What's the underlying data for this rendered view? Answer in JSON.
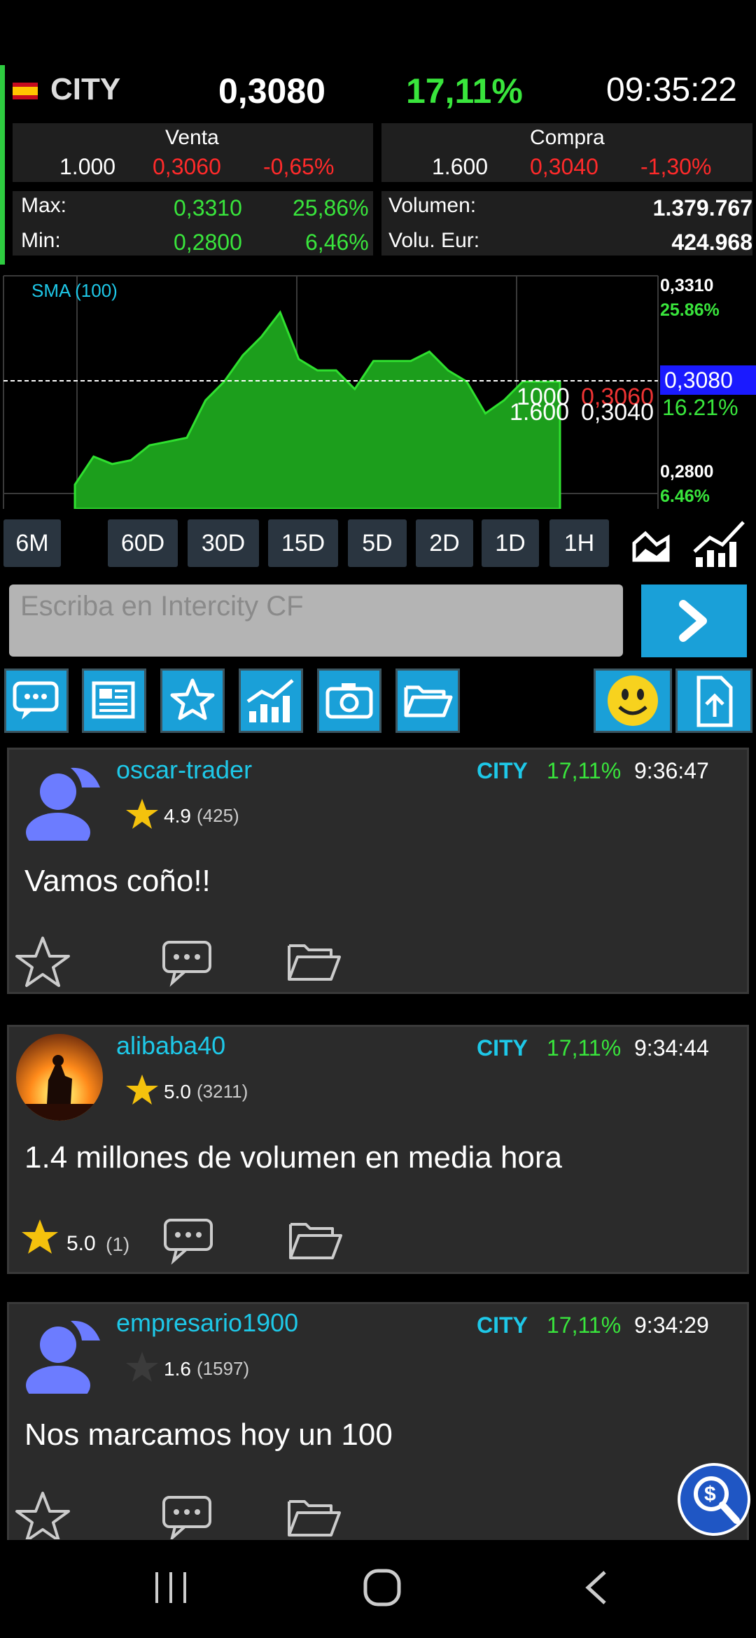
{
  "header": {
    "ticker": "CITY",
    "price": "0,3080",
    "change": "17,11%",
    "time": "09:35:22"
  },
  "orders": {
    "sell": {
      "title": "Venta",
      "qty": "1.000",
      "price": "0,3060",
      "pct": "-0,65%"
    },
    "buy": {
      "title": "Compra",
      "qty": "1.600",
      "price": "0,3040",
      "pct": "-1,30%"
    }
  },
  "stats": {
    "max_label": "Max:",
    "max_price": "0,3310",
    "max_pct": "25,86%",
    "min_label": "Min:",
    "min_price": "0,2800",
    "min_pct": "6,46%",
    "vol_label": "Volumen:",
    "vol_value": "1.379.767",
    "voleur_label": "Volu. Eur:",
    "voleur_value": "424.968"
  },
  "chart_data": {
    "type": "area",
    "legend": "SMA (100)",
    "ylim": [
      0.28,
      0.331
    ],
    "values": [
      0.2805,
      0.288,
      0.286,
      0.287,
      0.291,
      0.292,
      0.293,
      0.303,
      0.308,
      0.315,
      0.32,
      0.3265,
      0.314,
      0.311,
      0.311,
      0.306,
      0.3135,
      0.3135,
      0.3135,
      0.316,
      0.311,
      0.308,
      0.2995,
      0.303,
      0.308,
      0.308,
      0.308
    ],
    "ticks_right": [
      "0,3310",
      "25.86%",
      "0,3080",
      "16.21%",
      "0,2800",
      "6.46%"
    ],
    "overlay": [
      "1000",
      "0,3060",
      "1.600",
      "0,3040"
    ]
  },
  "timeframes": [
    "6M",
    "60D",
    "30D",
    "15D",
    "5D",
    "2D",
    "1D",
    "1H"
  ],
  "input": {
    "placeholder": "Escriba en Intercity CF"
  },
  "posts": [
    {
      "user": "oscar-trader",
      "ticker": "CITY",
      "pct": "17,11%",
      "time": "9:36:47",
      "rating": "4.9",
      "count": "(425)",
      "text": "Vamos coño!!"
    },
    {
      "user": "alibaba40",
      "ticker": "CITY",
      "pct": "17,11%",
      "time": "9:34:44",
      "rating": "5.0",
      "count": "(3211)",
      "text": "1.4 millones de volumen en media hora",
      "post_rating": "5.0",
      "post_count": "(1)"
    },
    {
      "user": "empresario1900",
      "ticker": "CITY",
      "pct": "17,11%",
      "time": "9:34:29",
      "rating": "1.6",
      "count": "(1597)",
      "text": "Nos marcamos hoy un 100"
    }
  ]
}
